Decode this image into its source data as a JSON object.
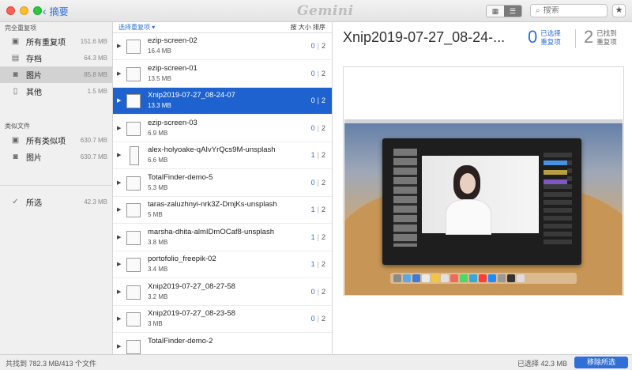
{
  "titlebar": {
    "back_label": "摘要",
    "app_logo": "Gemini",
    "search_placeholder": "搜索",
    "star_icon": "star-icon"
  },
  "sidebar": {
    "exact_header": "完全重复项",
    "similar_header": "类似文件",
    "exact_items": [
      {
        "label": "所有重复项",
        "size": "151.6 MB",
        "icon": "duplicates-icon"
      },
      {
        "label": "存档",
        "size": "64.3 MB",
        "icon": "archive-icon"
      },
      {
        "label": "图片",
        "size": "85.8 MB",
        "icon": "camera-icon"
      },
      {
        "label": "其他",
        "size": "1.5 MB",
        "icon": "document-icon"
      }
    ],
    "similar_items": [
      {
        "label": "所有类似项",
        "size": "630.7 MB",
        "icon": "similar-icon"
      },
      {
        "label": "图片",
        "size": "630.7 MB",
        "icon": "camera-icon"
      }
    ],
    "selected_item": {
      "label": "所选",
      "size": "42.3 MB",
      "icon": "check-icon"
    }
  },
  "list": {
    "select_duplicates_label": "选择重复项",
    "sort_label": "按 大小 排序",
    "rows": [
      {
        "name": "ezip-screen-02",
        "size": "16.4 MB",
        "selected_count": "0",
        "total_count": "2"
      },
      {
        "name": "ezip-screen-01",
        "size": "13.5 MB",
        "selected_count": "0",
        "total_count": "2"
      },
      {
        "name": "Xnip2019-07-27_08-24-07",
        "size": "13.3 MB",
        "selected_count": "0",
        "total_count": "2"
      },
      {
        "name": "ezip-screen-03",
        "size": "6.9 MB",
        "selected_count": "0",
        "total_count": "2"
      },
      {
        "name": "alex-holyoake-qAIvYrQcs9M-unsplash",
        "size": "6.6 MB",
        "selected_count": "1",
        "total_count": "2"
      },
      {
        "name": "TotalFinder-demo-5",
        "size": "5.3 MB",
        "selected_count": "0",
        "total_count": "2"
      },
      {
        "name": "taras-zaluzhnyi-nrk3Z-DmjKs-unsplash",
        "size": "5 MB",
        "selected_count": "1",
        "total_count": "2"
      },
      {
        "name": "marsha-dhita-almIDmOCaf8-unsplash",
        "size": "3.8 MB",
        "selected_count": "1",
        "total_count": "2"
      },
      {
        "name": "portofolio_freepik-02",
        "size": "3.4 MB",
        "selected_count": "1",
        "total_count": "2"
      },
      {
        "name": "Xnip2019-07-27_08-27-58",
        "size": "3.2 MB",
        "selected_count": "0",
        "total_count": "2"
      },
      {
        "name": "Xnip2019-07-27_08-23-58",
        "size": "3 MB",
        "selected_count": "0",
        "total_count": "2"
      },
      {
        "name": "TotalFinder-demo-2",
        "size": "",
        "selected_count": "",
        "total_count": ""
      }
    ]
  },
  "detail": {
    "title": "Xnip2019-07-27_08-24-...",
    "selected_count": "0",
    "selected_label_1": "已选择",
    "selected_label_2": "重复项",
    "found_count": "2",
    "found_label_1": "已找到",
    "found_label_2": "重复项"
  },
  "footer": {
    "found_text": "共找到 782.3 MB/413 个文件",
    "selected_text": "已选择 42.3 MB",
    "action_button": "移除所选"
  },
  "colors": {
    "accent": "#2f6fd6",
    "selection": "#1e62d0"
  }
}
